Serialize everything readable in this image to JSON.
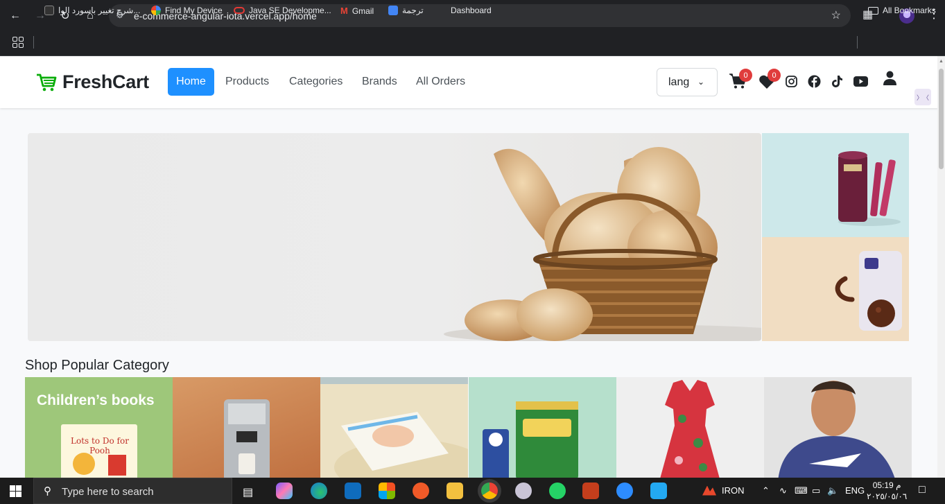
{
  "browser": {
    "url": "e-commerce-angular-iota.vercel.app/home",
    "bookmarks": [
      "شرح تغيير باسورد الوا...",
      "Find My Device",
      "Java SE Developme...",
      "Gmail",
      "ترجمة",
      "Dashboard"
    ],
    "all_bookmarks": "All Bookmarks"
  },
  "site": {
    "logo": "FreshCart",
    "nav": [
      "Home",
      "Products",
      "Categories",
      "Brands",
      "All Orders"
    ],
    "active_nav": "Home",
    "lang_label": "lang",
    "cart_count": "0",
    "wishlist_count": "0",
    "accent": "#1e90ff",
    "brand_green": "#0aad0a"
  },
  "section": {
    "title": "Shop Popular Category",
    "categories": [
      {
        "label": "Children’s books",
        "book_title": "Lots to Do for Pooh"
      },
      {
        "label": ""
      },
      {
        "label": ""
      },
      {
        "label": ""
      },
      {
        "label": ""
      },
      {
        "label": ""
      }
    ]
  },
  "taskbar": {
    "search_placeholder": "Type here to search",
    "iron_label": "IRON",
    "lang": "ENG",
    "time": "05:19 م",
    "date": "٢٠٢٥/٠٥/٠٦"
  }
}
